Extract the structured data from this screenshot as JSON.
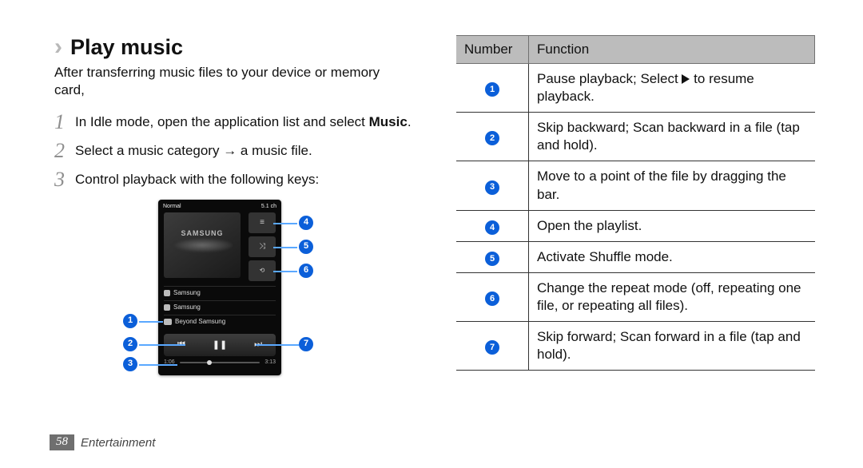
{
  "heading": "Play music",
  "intro": "After transferring music files to your device or memory card,",
  "steps": [
    {
      "n": "1",
      "before": "In Idle mode, open the application list and select ",
      "bold": "Music",
      "after": "."
    },
    {
      "n": "2",
      "before": "Select a music category → a music file.",
      "bold": "",
      "after": ""
    },
    {
      "n": "3",
      "before": "Control playback with the following keys:",
      "bold": "",
      "after": ""
    }
  ],
  "phone": {
    "topbar_left": "Normal",
    "topbar_right": "5.1 ch",
    "art_logo": "SAMSUNG",
    "rows": [
      "Samsung",
      "Samsung",
      "Beyond Samsung"
    ],
    "time_left": "1:06",
    "time_right": "3:13",
    "ctrl_prev": "⏮",
    "ctrl_pause": "❚❚",
    "ctrl_next": "⏭"
  },
  "callouts_left": [
    "1",
    "2",
    "3"
  ],
  "callouts_right": [
    "4",
    "5",
    "6",
    "7"
  ],
  "table": {
    "header": {
      "number": "Number",
      "function": "Function"
    },
    "rows": [
      {
        "n": "1",
        "f_before": "Pause playback; Select ",
        "f_icon": "play",
        "f_after": " to resume playback."
      },
      {
        "n": "2",
        "f": "Skip backward; Scan backward in a file (tap and hold)."
      },
      {
        "n": "3",
        "f": "Move to a point of the file by dragging the bar."
      },
      {
        "n": "4",
        "f": "Open the playlist."
      },
      {
        "n": "5",
        "f": "Activate Shuffle mode."
      },
      {
        "n": "6",
        "f": "Change the repeat mode (off, repeating one file, or repeating all files)."
      },
      {
        "n": "7",
        "f": "Skip forward; Scan forward in a file (tap and hold)."
      }
    ]
  },
  "footer": {
    "page": "58",
    "section": "Entertainment"
  }
}
